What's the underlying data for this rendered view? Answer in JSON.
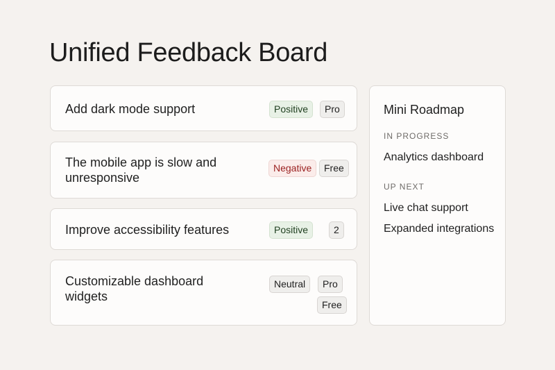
{
  "page": {
    "title": "Unified Feedback Board"
  },
  "feedback": [
    {
      "text": "Add dark mode support",
      "sentiment": "Positive",
      "tags": [
        "Pro"
      ]
    },
    {
      "text": "The mobile app is slow and unresponsive",
      "sentiment": "Negative",
      "tags": [
        "Free"
      ]
    },
    {
      "text": "Improve accessibility features",
      "sentiment": "Positive",
      "tags": [
        "2"
      ]
    },
    {
      "text": "Customizable dashboard widgets",
      "sentiment": "Neutral",
      "tags": [
        "Pro",
        "Free"
      ]
    }
  ],
  "roadmap": {
    "title": "Mini Roadmap",
    "in_progress_label": "IN PROGRESS",
    "in_progress": [
      "Analytics dashboard"
    ],
    "up_next_label": "UP NEXT",
    "up_next": [
      "Live chat support",
      "Expanded integrations"
    ]
  },
  "colors": {
    "positive": "#e8f1e6",
    "negative_text": "#9a1f1f",
    "neutral": "#efeeec"
  }
}
